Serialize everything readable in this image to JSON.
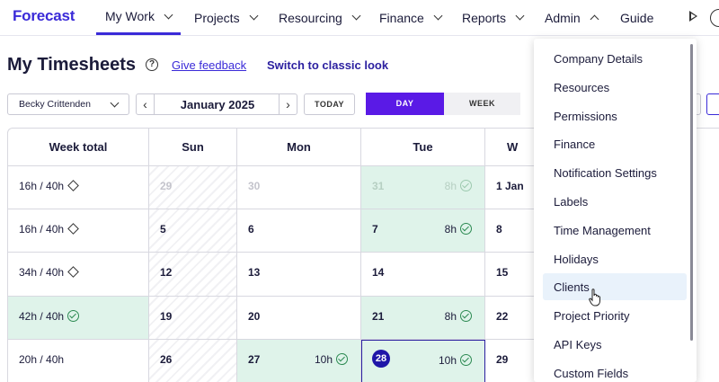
{
  "nav": {
    "logo": "Forecast",
    "items": [
      {
        "label": "My Work",
        "chevron": true
      },
      {
        "label": "Projects",
        "chevron": true
      },
      {
        "label": "Resourcing",
        "chevron": true
      },
      {
        "label": "Finance",
        "chevron": true
      },
      {
        "label": "Reports",
        "chevron": true
      },
      {
        "label": "Admin",
        "chevron": "up"
      },
      {
        "label": "Guide",
        "chevron": false
      }
    ],
    "active": "My Work"
  },
  "page": {
    "title": "My Timesheets",
    "help_glyph": "?",
    "feedback_link": "Give feedback",
    "classic_link": "Switch to classic look"
  },
  "controls": {
    "person": "Becky Crittenden",
    "prev": "‹",
    "next": "›",
    "month": "January 2025",
    "today": "TODAY",
    "day": "DAY",
    "week": "WEEK"
  },
  "table": {
    "headers": [
      "Week total",
      "Sun",
      "Mon",
      "Tue",
      "W"
    ],
    "rows": [
      {
        "total": "16h / 40h",
        "status": "warning",
        "cells": [
          {
            "day": "29",
            "muted": true,
            "hatch": true
          },
          {
            "day": "30",
            "muted": true
          },
          {
            "day": "31",
            "muted": true,
            "hours": "8h",
            "check": "faded",
            "green": true
          },
          {
            "day": "1 Jan"
          }
        ]
      },
      {
        "total": "16h / 40h",
        "status": "warning",
        "cells": [
          {
            "day": "5",
            "hatch": true
          },
          {
            "day": "6"
          },
          {
            "day": "7",
            "hours": "8h",
            "check": "on",
            "green": true
          },
          {
            "day": "8"
          }
        ]
      },
      {
        "total": "34h / 40h",
        "status": "warning",
        "cells": [
          {
            "day": "12",
            "hatch": true
          },
          {
            "day": "13"
          },
          {
            "day": "14"
          },
          {
            "day": "15"
          }
        ]
      },
      {
        "total": "42h / 40h",
        "status": "done",
        "green_total": true,
        "cells": [
          {
            "day": "19",
            "hatch": true
          },
          {
            "day": "20"
          },
          {
            "day": "21",
            "hours": "8h",
            "check": "on",
            "green": true
          },
          {
            "day": "22"
          }
        ]
      },
      {
        "total": "20h / 40h",
        "status": "none",
        "cells": [
          {
            "day": "26",
            "hatch": true
          },
          {
            "day": "27",
            "hours": "10h",
            "check": "on",
            "green": true
          },
          {
            "day": "28",
            "hours": "10h",
            "check": "on",
            "today": true
          },
          {
            "day": "29"
          }
        ]
      }
    ]
  },
  "admin_menu": {
    "items": [
      "Company Details",
      "Resources",
      "Permissions",
      "Finance",
      "Notification Settings",
      "Labels",
      "Time Management",
      "Holidays",
      "Clients",
      "Project Priority",
      "API Keys",
      "Custom Fields"
    ],
    "hovered": "Clients"
  },
  "colors": {
    "brand": "#3a2ad8",
    "day_toggle": "#5a1ae6",
    "approved_fill": "#dff3ea",
    "check_green": "#2c8a52",
    "today_badge": "#1f16a8",
    "menu_hover": "#e9f2fb"
  },
  "icons": [
    "play-icon",
    "help-icon",
    "chevron-down-icon",
    "chevron-up-icon",
    "diamond-warning-icon",
    "check-circle-icon",
    "hand-cursor-icon"
  ]
}
